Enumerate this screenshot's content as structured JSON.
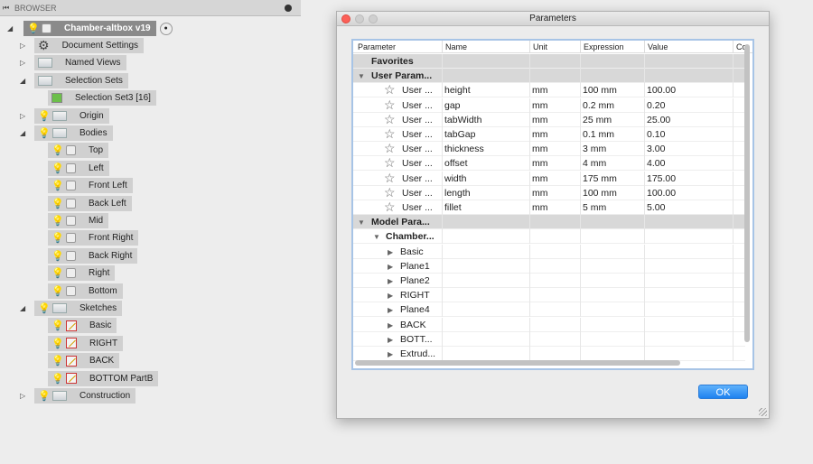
{
  "browser": {
    "title": "BROWSER",
    "root": "Chamber-altbox v19",
    "items": [
      {
        "label": "Document Settings",
        "level": 1,
        "icon": "gear-icon",
        "exp": "collapsed"
      },
      {
        "label": "Named Views",
        "level": 1,
        "icon": "folder-icon",
        "exp": "collapsed"
      },
      {
        "label": "Selection Sets",
        "level": 1,
        "icon": "folder-icon",
        "exp": "expanded"
      },
      {
        "label": "Selection Set3 [16]",
        "level": 2,
        "icon": "selection-set-icon",
        "exp": "none"
      },
      {
        "label": "Origin",
        "level": 1,
        "icon": "folder-icon",
        "bulb": "b",
        "exp": "collapsed"
      },
      {
        "label": "Bodies",
        "level": 1,
        "icon": "folder-icon",
        "bulb": "b",
        "exp": "expanded"
      },
      {
        "label": "Top",
        "level": 2,
        "icon": "body-icon",
        "bulb": "y"
      },
      {
        "label": "Left",
        "level": 2,
        "icon": "body-icon",
        "bulb": "y"
      },
      {
        "label": "Front Left",
        "level": 2,
        "icon": "body-icon",
        "bulb": "y"
      },
      {
        "label": "Back Left",
        "level": 2,
        "icon": "body-icon",
        "bulb": "y"
      },
      {
        "label": "Mid",
        "level": 2,
        "icon": "body-icon",
        "bulb": "y"
      },
      {
        "label": "Front Right",
        "level": 2,
        "icon": "body-icon",
        "bulb": "y"
      },
      {
        "label": "Back Right",
        "level": 2,
        "icon": "body-icon",
        "bulb": "y"
      },
      {
        "label": "Right",
        "level": 2,
        "icon": "body-icon",
        "bulb": "y"
      },
      {
        "label": "Bottom",
        "level": 2,
        "icon": "body-icon",
        "bulb": "y"
      },
      {
        "label": "Sketches",
        "level": 1,
        "icon": "folder-icon",
        "bulb": "y",
        "exp": "expanded"
      },
      {
        "label": "Basic",
        "level": 2,
        "icon": "sketch-icon",
        "bulb": "b"
      },
      {
        "label": "RIGHT",
        "level": 2,
        "icon": "sketch-icon",
        "bulb": "b"
      },
      {
        "label": "BACK",
        "level": 2,
        "icon": "sketch-icon",
        "bulb": "b"
      },
      {
        "label": "BOTTOM PartB",
        "level": 2,
        "icon": "sketch-icon",
        "bulb": "b"
      },
      {
        "label": "Construction",
        "level": 1,
        "icon": "folder-icon",
        "bulb": "b",
        "exp": "collapsed"
      }
    ]
  },
  "dialog": {
    "title": "Parameters",
    "ok": "OK",
    "columns": [
      "Parameter",
      "Name",
      "Unit",
      "Expression",
      "Value",
      "Co"
    ],
    "groups": {
      "favorites": "Favorites",
      "user": "User Param...",
      "model": "Model Para...",
      "chamber": "Chamber..."
    },
    "user_params": [
      {
        "param": "User ...",
        "name": "height",
        "unit": "mm",
        "expr": "100 mm",
        "value": "100.00"
      },
      {
        "param": "User ...",
        "name": "gap",
        "unit": "mm",
        "expr": "0.2 mm",
        "value": "0.20"
      },
      {
        "param": "User ...",
        "name": "tabWidth",
        "unit": "mm",
        "expr": "25 mm",
        "value": "25.00"
      },
      {
        "param": "User ...",
        "name": "tabGap",
        "unit": "mm",
        "expr": "0.1 mm",
        "value": "0.10"
      },
      {
        "param": "User ...",
        "name": "thickness",
        "unit": "mm",
        "expr": "3 mm",
        "value": "3.00"
      },
      {
        "param": "User ...",
        "name": "offset",
        "unit": "mm",
        "expr": "4 mm",
        "value": "4.00"
      },
      {
        "param": "User ...",
        "name": "width",
        "unit": "mm",
        "expr": "175 mm",
        "value": "175.00"
      },
      {
        "param": "User ...",
        "name": "length",
        "unit": "mm",
        "expr": "100 mm",
        "value": "100.00"
      },
      {
        "param": "User ...",
        "name": "fillet",
        "unit": "mm",
        "expr": "5 mm",
        "value": "5.00"
      }
    ],
    "features": [
      "Basic",
      "Plane1",
      "Plane2",
      "RIGHT",
      "Plane4",
      "BACK",
      "BOTT...",
      "Extrud..."
    ]
  }
}
